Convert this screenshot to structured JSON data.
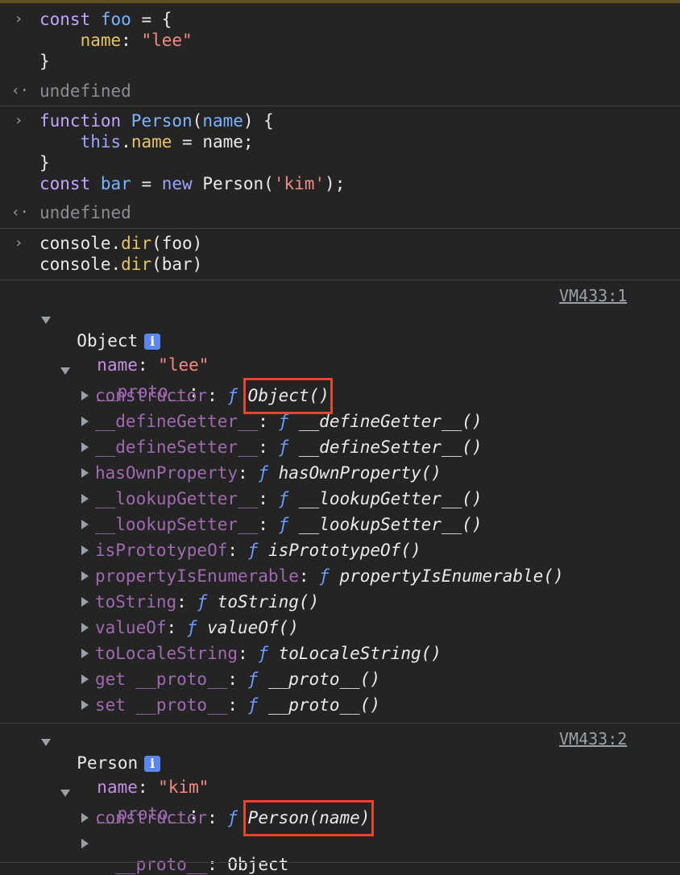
{
  "inputs": [
    {
      "lines": [
        [
          {
            "t": "const ",
            "c": "kw2"
          },
          {
            "t": "foo",
            "c": "var"
          },
          {
            "t": " = {",
            "c": "plain"
          }
        ],
        [
          {
            "t": "    ",
            "c": "plain"
          },
          {
            "t": "name",
            "c": "prop"
          },
          {
            "t": ": ",
            "c": "plain"
          },
          {
            "t": "\"lee\"",
            "c": "str"
          }
        ],
        [
          {
            "t": "}",
            "c": "plain"
          }
        ]
      ],
      "result": "undefined"
    },
    {
      "lines": [
        [
          {
            "t": "function ",
            "c": "kw2"
          },
          {
            "t": "Person",
            "c": "func"
          },
          {
            "t": "(",
            "c": "plain"
          },
          {
            "t": "name",
            "c": "var"
          },
          {
            "t": ") {",
            "c": "plain"
          }
        ],
        [
          {
            "t": "    ",
            "c": "plain"
          },
          {
            "t": "this",
            "c": "kw"
          },
          {
            "t": ".",
            "c": "plain"
          },
          {
            "t": "name",
            "c": "prop"
          },
          {
            "t": " = name;",
            "c": "plain"
          }
        ],
        [
          {
            "t": "}",
            "c": "plain"
          }
        ],
        [
          {
            "t": "const ",
            "c": "kw2"
          },
          {
            "t": "bar",
            "c": "var"
          },
          {
            "t": " = ",
            "c": "plain"
          },
          {
            "t": "new ",
            "c": "kw"
          },
          {
            "t": "Person(",
            "c": "plain"
          },
          {
            "t": "'kim'",
            "c": "str"
          },
          {
            "t": ");",
            "c": "plain"
          }
        ]
      ],
      "result": "undefined"
    },
    {
      "lines": [
        [
          {
            "t": "console.",
            "c": "plain"
          },
          {
            "t": "dir",
            "c": "meth"
          },
          {
            "t": "(foo)",
            "c": "plain"
          }
        ],
        [
          {
            "t": "console.",
            "c": "plain"
          },
          {
            "t": "dir",
            "c": "meth"
          },
          {
            "t": "(bar)",
            "c": "plain"
          }
        ]
      ]
    }
  ],
  "output1": {
    "source": "VM433:1",
    "title": "Object",
    "info_icon": "i",
    "name_key": "name",
    "name_value": "\"lee\"",
    "proto_key": "__proto__",
    "entries": [
      {
        "key": "constructor",
        "fn": "Object()",
        "highlight": true
      },
      {
        "key": "__defineGetter__",
        "fn": "__defineGetter__()"
      },
      {
        "key": "__defineSetter__",
        "fn": "__defineSetter__()"
      },
      {
        "key": "hasOwnProperty",
        "fn": "hasOwnProperty()"
      },
      {
        "key": "__lookupGetter__",
        "fn": "__lookupGetter__()"
      },
      {
        "key": "__lookupSetter__",
        "fn": "__lookupSetter__()"
      },
      {
        "key": "isPrototypeOf",
        "fn": "isPrototypeOf()"
      },
      {
        "key": "propertyIsEnumerable",
        "fn": "propertyIsEnumerable()"
      },
      {
        "key": "toString",
        "fn": "toString()"
      },
      {
        "key": "valueOf",
        "fn": "valueOf()"
      },
      {
        "key": "toLocaleString",
        "fn": "toLocaleString()"
      },
      {
        "key": "get __proto__",
        "fn": "__proto__()"
      },
      {
        "key": "set __proto__",
        "fn": "__proto__()"
      }
    ]
  },
  "output2": {
    "source": "VM433:2",
    "title": "Person",
    "info_icon": "i",
    "name_key": "name",
    "name_value": "\"kim\"",
    "proto_key": "__proto__",
    "entries": [
      {
        "key": "constructor",
        "fn": "Person(name)",
        "highlight": true
      }
    ],
    "tail": {
      "key": "__proto__",
      "value": "Object"
    }
  },
  "symbols": {
    "fn": "ƒ",
    "colon": ": "
  },
  "colors": {
    "highlight_border": "#e8452e",
    "background": "#242424",
    "info_badge": "#5a86f0"
  }
}
